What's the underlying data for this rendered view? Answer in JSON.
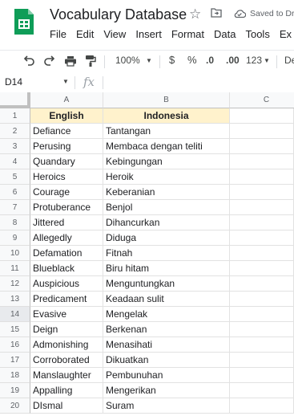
{
  "app": {
    "doc_title": "Vocabulary Database",
    "save_status": "Saved to Dr"
  },
  "menu": [
    "File",
    "Edit",
    "View",
    "Insert",
    "Format",
    "Data",
    "Tools",
    "Ex"
  ],
  "toolbar": {
    "zoom": "100%",
    "currency": "$",
    "percent": "%",
    "decrease_decimal": ".0",
    "increase_decimal": ".00",
    "more_formats": "123",
    "font": "De"
  },
  "formula_bar": {
    "cell_ref": "D14",
    "fx_label": "fx",
    "value": ""
  },
  "columns": [
    "A",
    "B",
    "C"
  ],
  "rows": [
    {
      "num": "1",
      "a": "English",
      "b": "Indonesia"
    },
    {
      "num": "2",
      "a": "Defiance",
      "b": "Tantangan"
    },
    {
      "num": "3",
      "a": "Perusing",
      "b": "Membaca dengan teliti"
    },
    {
      "num": "4",
      "a": "Quandary",
      "b": "Kebingungan"
    },
    {
      "num": "5",
      "a": "Heroics",
      "b": "Heroik"
    },
    {
      "num": "6",
      "a": "Courage",
      "b": "Keberanian"
    },
    {
      "num": "7",
      "a": "Protuberance",
      "b": "Benjol"
    },
    {
      "num": "8",
      "a": "Jittered",
      "b": "Dihancurkan"
    },
    {
      "num": "9",
      "a": "Allegedly",
      "b": "Diduga"
    },
    {
      "num": "10",
      "a": "Defamation",
      "b": "Fitnah"
    },
    {
      "num": "11",
      "a": "Blueblack",
      "b": "Biru hitam"
    },
    {
      "num": "12",
      "a": "Auspicious",
      "b": "Menguntungkan"
    },
    {
      "num": "13",
      "a": "Predicament",
      "b": "Keadaan sulit"
    },
    {
      "num": "14",
      "a": "Evasive",
      "b": "Mengelak"
    },
    {
      "num": "15",
      "a": "Deign",
      "b": "Berkenan"
    },
    {
      "num": "16",
      "a": "Admonishing",
      "b": "Menasihati"
    },
    {
      "num": "17",
      "a": "Corroborated",
      "b": "Dikuatkan"
    },
    {
      "num": "18",
      "a": "Manslaughter",
      "b": "Pembunuhan"
    },
    {
      "num": "19",
      "a": "Appalling",
      "b": "Mengerikan"
    },
    {
      "num": "20",
      "a": "DIsmal",
      "b": "Suram"
    }
  ]
}
